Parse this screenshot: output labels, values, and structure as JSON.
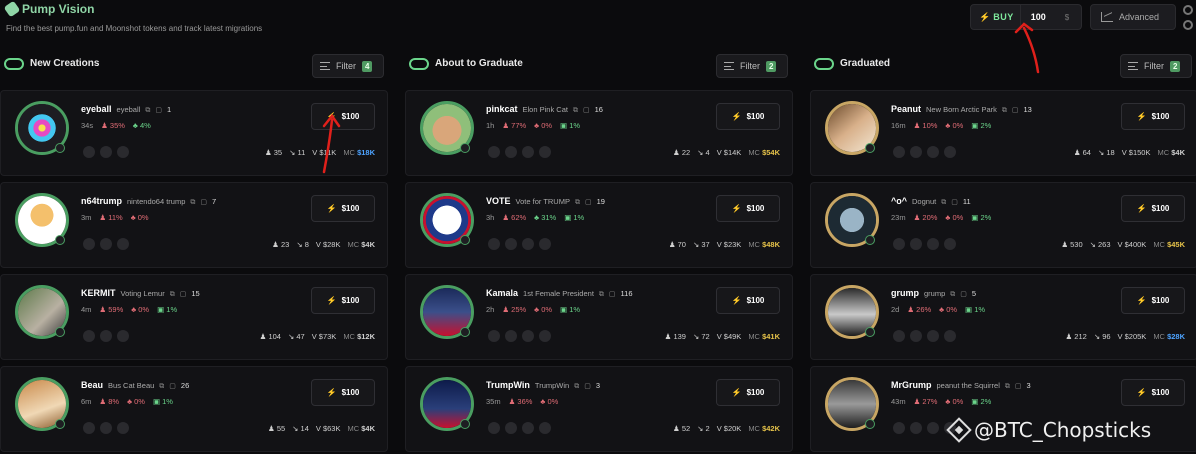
{
  "header": {
    "title": "Pump Vision",
    "subtitle": "Find the best pump.fun and Moonshot tokens and track latest migrations",
    "buy_label": "BUY",
    "buy_amount": "100",
    "buy_unit": "$",
    "advanced_label": "Advanced"
  },
  "columns": [
    {
      "title": "New Creations",
      "filter_label": "Filter",
      "filter_count": "4",
      "tokens": [
        {
          "ticker": "eyeball",
          "name": "eyeball",
          "replies": "1",
          "age": "34s",
          "holders_pct": "35%",
          "dev_pct": "4%",
          "dev_green": true,
          "top10": "",
          "holders": "35",
          "txns": "11",
          "volume": "V $11K",
          "mc": "$18K",
          "mc_color": "#4da3ff",
          "buy": "$100",
          "avatar": "eye"
        },
        {
          "ticker": "n64trump",
          "name": "nintendo64 trump",
          "replies": "7",
          "age": "3m",
          "holders_pct": "11%",
          "dev_pct": "0%",
          "dev_green": false,
          "top10": "",
          "holders": "23",
          "txns": "8",
          "volume": "V $28K",
          "mc": "$4K",
          "mc_color": "#cfcfcf",
          "buy": "$100",
          "avatar": "trump64"
        },
        {
          "ticker": "KERMIT",
          "name": "Voting Lemur",
          "replies": "15",
          "age": "4m",
          "holders_pct": "59%",
          "dev_pct": "0%",
          "dev_green": false,
          "top10": "1%",
          "holders": "104",
          "txns": "47",
          "volume": "V $73K",
          "mc": "$12K",
          "mc_color": "#cfcfcf",
          "buy": "$100",
          "avatar": "lemur"
        },
        {
          "ticker": "Beau",
          "name": "Bus Cat Beau",
          "replies": "26",
          "age": "6m",
          "holders_pct": "8%",
          "dev_pct": "0%",
          "dev_green": false,
          "top10": "1%",
          "holders": "55",
          "txns": "14",
          "volume": "V $63K",
          "mc": "$4K",
          "mc_color": "#cfcfcf",
          "buy": "$100",
          "avatar": "cat"
        }
      ]
    },
    {
      "title": "About to Graduate",
      "filter_label": "Filter",
      "filter_count": "2",
      "tokens": [
        {
          "ticker": "pinkcat",
          "name": "Elon Pink Cat",
          "replies": "16",
          "age": "1h",
          "holders_pct": "77%",
          "dev_pct": "0%",
          "dev_green": false,
          "top10": "1%",
          "holders": "22",
          "txns": "4",
          "volume": "V $14K",
          "mc": "$54K",
          "mc_color": "#e6c34a",
          "buy": "$100",
          "avatar": "pinkcat"
        },
        {
          "ticker": "VOTE",
          "name": "Vote for TRUMP",
          "replies": "19",
          "age": "3h",
          "holders_pct": "62%",
          "dev_pct": "31%",
          "dev_green": true,
          "top10": "1%",
          "holders": "70",
          "txns": "37",
          "volume": "V $23K",
          "mc": "$48K",
          "mc_color": "#e6c34a",
          "buy": "$100",
          "avatar": "vote"
        },
        {
          "ticker": "Kamala",
          "name": "1st Female President",
          "replies": "116",
          "age": "2h",
          "holders_pct": "25%",
          "dev_pct": "0%",
          "dev_green": false,
          "top10": "1%",
          "holders": "139",
          "txns": "72",
          "volume": "V $49K",
          "mc": "$41K",
          "mc_color": "#e6c34a",
          "buy": "$100",
          "avatar": "kamala"
        },
        {
          "ticker": "TrumpWin",
          "name": "TrumpWin",
          "replies": "3",
          "age": "35m",
          "holders_pct": "36%",
          "dev_pct": "0%",
          "dev_green": false,
          "top10": "",
          "holders": "52",
          "txns": "2",
          "volume": "V $20K",
          "mc": "$42K",
          "mc_color": "#e6c34a",
          "buy": "$100",
          "avatar": "trumpwin"
        }
      ]
    },
    {
      "title": "Graduated",
      "filter_label": "Filter",
      "filter_count": "2",
      "tokens": [
        {
          "ticker": "Peanut",
          "name": "New Born Arctic Park",
          "replies": "13",
          "age": "16m",
          "holders_pct": "10%",
          "dev_pct": "0%",
          "dev_green": false,
          "top10": "2%",
          "holders": "64",
          "txns": "18",
          "volume": "V $150K",
          "mc": "$4K",
          "mc_color": "#cfcfcf",
          "buy": "$100",
          "avatar": "peanut"
        },
        {
          "ticker": "^o^",
          "name": "Dognut",
          "replies": "11",
          "age": "23m",
          "holders_pct": "20%",
          "dev_pct": "0%",
          "dev_green": false,
          "top10": "2%",
          "holders": "530",
          "txns": "263",
          "volume": "V $400K",
          "mc": "$45K",
          "mc_color": "#e6c34a",
          "buy": "$100",
          "avatar": "dog"
        },
        {
          "ticker": "grump",
          "name": "grump",
          "replies": "5",
          "age": "2d",
          "holders_pct": "26%",
          "dev_pct": "0%",
          "dev_green": false,
          "top10": "1%",
          "holders": "212",
          "txns": "96",
          "volume": "V $205K",
          "mc": "$28K",
          "mc_color": "#4da3ff",
          "buy": "$100",
          "avatar": "grump"
        },
        {
          "ticker": "MrGrump",
          "name": "peanut the Squirrel",
          "replies": "3",
          "age": "43m",
          "holders_pct": "27%",
          "dev_pct": "0%",
          "dev_green": false,
          "top10": "2%",
          "holders": "",
          "txns": "",
          "volume": "",
          "mc": "",
          "mc_color": "#cfcfcf",
          "buy": "$100",
          "avatar": "mrgrump"
        }
      ]
    }
  ],
  "watermark": "@BTC_Chopsticks",
  "colors": {
    "accent_green": "#6bd58b",
    "warn_red": "#e06c75",
    "gold": "#e6c34a",
    "blue": "#4da3ff",
    "annotation_red": "#e0201b"
  }
}
